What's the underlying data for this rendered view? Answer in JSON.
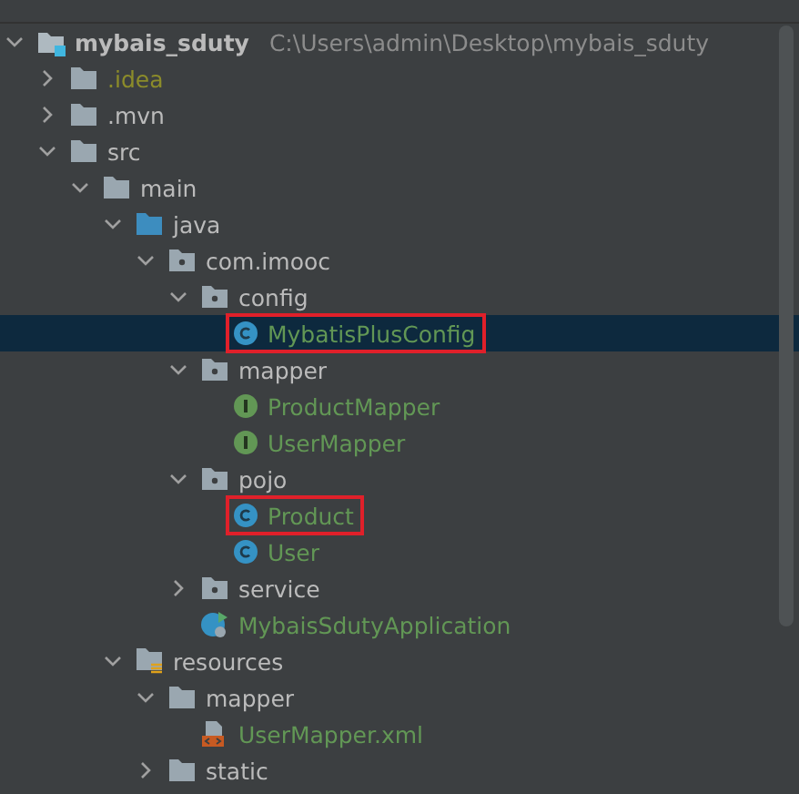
{
  "tree": [
    {
      "label": "mybais_sduty",
      "path": "C:\\Users\\admin\\Desktop\\mybais_sduty",
      "kind": "project",
      "added": false,
      "ignored": false,
      "expanded": true,
      "selected": false,
      "outlined": false,
      "children": [
        {
          "label": ".idea",
          "kind": "folder",
          "added": false,
          "ignored": true,
          "expanded": false,
          "selected": false,
          "outlined": false
        },
        {
          "label": ".mvn",
          "kind": "folder",
          "added": false,
          "ignored": false,
          "expanded": false,
          "selected": false,
          "outlined": false
        },
        {
          "label": "src",
          "kind": "folder",
          "added": false,
          "ignored": false,
          "expanded": true,
          "selected": false,
          "outlined": false,
          "children": [
            {
              "label": "main",
              "kind": "folder",
              "added": false,
              "ignored": false,
              "expanded": true,
              "selected": false,
              "outlined": false,
              "children": [
                {
                  "label": "java",
                  "kind": "source-folder",
                  "added": false,
                  "ignored": false,
                  "expanded": true,
                  "selected": false,
                  "outlined": false,
                  "children": [
                    {
                      "label": "com.imooc",
                      "kind": "package",
                      "added": false,
                      "ignored": false,
                      "expanded": true,
                      "selected": false,
                      "outlined": false,
                      "children": [
                        {
                          "label": "config",
                          "kind": "package",
                          "added": false,
                          "ignored": false,
                          "expanded": true,
                          "selected": false,
                          "outlined": false,
                          "children": [
                            {
                              "label": "MybatisPlusConfig",
                              "kind": "class",
                              "added": true,
                              "ignored": false,
                              "selected": true,
                              "outlined": true
                            }
                          ]
                        },
                        {
                          "label": "mapper",
                          "kind": "package",
                          "added": false,
                          "ignored": false,
                          "expanded": true,
                          "selected": false,
                          "outlined": false,
                          "children": [
                            {
                              "label": "ProductMapper",
                              "kind": "interface",
                              "added": true,
                              "ignored": false,
                              "selected": false,
                              "outlined": false
                            },
                            {
                              "label": "UserMapper",
                              "kind": "interface",
                              "added": true,
                              "ignored": false,
                              "selected": false,
                              "outlined": false
                            }
                          ]
                        },
                        {
                          "label": "pojo",
                          "kind": "package",
                          "added": false,
                          "ignored": false,
                          "expanded": true,
                          "selected": false,
                          "outlined": false,
                          "children": [
                            {
                              "label": "Product",
                              "kind": "class",
                              "added": true,
                              "ignored": false,
                              "selected": false,
                              "outlined": true
                            },
                            {
                              "label": "User",
                              "kind": "class",
                              "added": true,
                              "ignored": false,
                              "selected": false,
                              "outlined": false
                            }
                          ]
                        },
                        {
                          "label": "service",
                          "kind": "package",
                          "added": false,
                          "ignored": false,
                          "expanded": false,
                          "selected": false,
                          "outlined": false
                        },
                        {
                          "label": "MybaisSdutyApplication",
                          "kind": "app",
                          "added": true,
                          "ignored": false,
                          "selected": false,
                          "outlined": false
                        }
                      ]
                    }
                  ]
                },
                {
                  "label": "resources",
                  "kind": "resources-folder",
                  "added": false,
                  "ignored": false,
                  "expanded": true,
                  "selected": false,
                  "outlined": false,
                  "children": [
                    {
                      "label": "mapper",
                      "kind": "folder",
                      "added": false,
                      "ignored": false,
                      "expanded": true,
                      "selected": false,
                      "outlined": false,
                      "children": [
                        {
                          "label": "UserMapper.xml",
                          "kind": "xml",
                          "added": true,
                          "ignored": false,
                          "selected": false,
                          "outlined": false
                        }
                      ]
                    },
                    {
                      "label": "static",
                      "kind": "folder",
                      "added": false,
                      "ignored": false,
                      "expanded": false,
                      "selected": false,
                      "outlined": false
                    }
                  ]
                }
              ]
            }
          ]
        }
      ]
    }
  ]
}
